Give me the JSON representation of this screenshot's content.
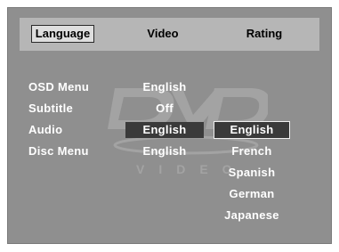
{
  "tabs": [
    {
      "label": "Language",
      "active": true
    },
    {
      "label": "Video",
      "active": false
    },
    {
      "label": "Rating",
      "active": false
    }
  ],
  "settings": [
    {
      "label": "OSD Menu",
      "value": "English",
      "selected": false
    },
    {
      "label": "Subtitle",
      "value": "Off",
      "selected": false
    },
    {
      "label": "Audio",
      "value": "English",
      "selected": true
    },
    {
      "label": "Disc Menu",
      "value": "English",
      "selected": false
    }
  ],
  "options": [
    "English",
    "French",
    "Spanish",
    "German",
    "Japanese"
  ],
  "selected_option": "English",
  "watermark": {
    "logo_text": "DVD",
    "sub_text": "VIDEO"
  },
  "colors": {
    "panel": "#8f8f8f",
    "topbar": "#b6b6b6",
    "active_tab": "#dedede",
    "highlight": "#3a3a3a",
    "text": "#ffffff"
  }
}
